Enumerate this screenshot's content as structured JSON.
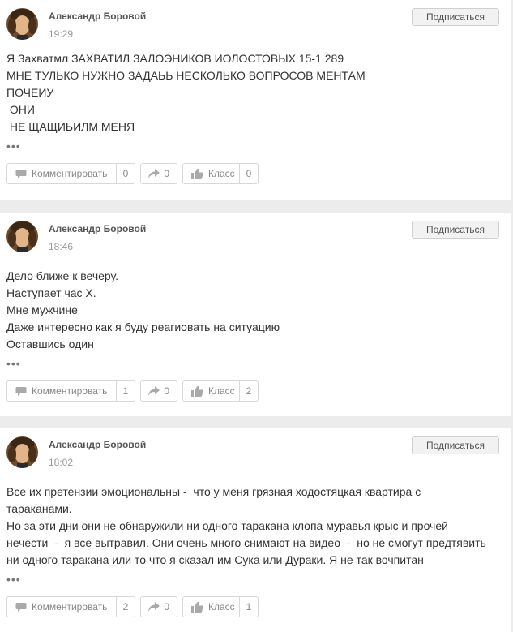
{
  "posts": [
    {
      "author": "Александр Боровой",
      "time": "19:29",
      "subscribe_label": "Подписаться",
      "lines": [
        "Я Захватмл ЗАХВАТИЛ ЗАЛОЭНИКОВ ИОЛОСТОВЫХ 15-1 289",
        "МНЕ ТУЛЬКО НУЖНО ЗАДАЬЬ НЕСКОЛЬКО ВОПРОСОВ МЕНТАМ",
        "ПОЧЕИУ",
        " ОНИ",
        " НЕ ЩАЩИЬИЛМ МЕНЯ"
      ],
      "more": "•••",
      "comment_label": "Комментировать",
      "comment_count": "0",
      "share_count": "0",
      "like_label": "Класс",
      "like_count": "0"
    },
    {
      "author": "Александр Боровой",
      "time": "18:46",
      "subscribe_label": "Подписаться",
      "lines": [
        "Дело ближе к вечеру.",
        "Наступает час Х.",
        "Мне мужчине",
        "Даже интересно как я буду реагиовать на ситуацию",
        "Оставшись один"
      ],
      "more": "•••",
      "comment_label": "Комментировать",
      "comment_count": "1",
      "share_count": "0",
      "like_label": "Класс",
      "like_count": "2"
    },
    {
      "author": "Александр Боровой",
      "time": "18:02",
      "subscribe_label": "Подписаться",
      "lines": [
        "Все их претензии эмоциональны -  что у меня грязная ходостяцкая квартира с",
        "тараканами.",
        "Но за эти дни они не обнаружили ни одного таракана клопа муравья крыс и прочей",
        "нечести  -  я все вытравил. Они очень много снимают на видео  -  но не смогут предтявить",
        "ни одного таракана или то что я сказал им Сука или Дураки. Я не так вочпитан"
      ],
      "more": "•••",
      "comment_label": "Комментировать",
      "comment_count": "2",
      "share_count": "0",
      "like_label": "Класс",
      "like_count": "1"
    }
  ],
  "icons": {
    "avatar": "avatar-photo",
    "comment": "comment-bubble-icon",
    "share": "share-arrow-icon",
    "like": "thumbs-up-icon"
  },
  "colors": {
    "background": "#ececec",
    "card": "#ffffff",
    "border": "#d8d8d8",
    "author": "#555555",
    "muted": "#999999"
  }
}
